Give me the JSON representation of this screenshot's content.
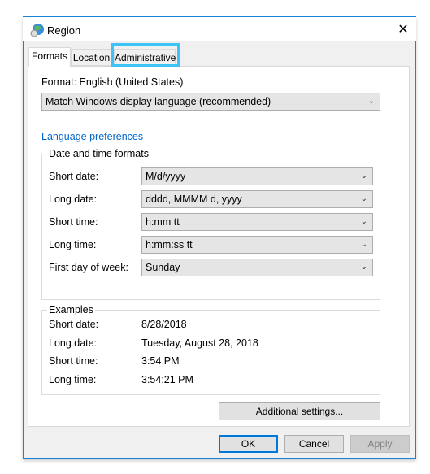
{
  "window": {
    "title": "Region",
    "icon": "globe-clock-icon",
    "close_icon": "close-icon"
  },
  "tabs": [
    {
      "label": "Formats",
      "selected": true
    },
    {
      "label": "Location"
    },
    {
      "label": "Administrative",
      "highlighted": true
    }
  ],
  "format": {
    "label": "Format: English (United States)",
    "value": "Match Windows display language (recommended)"
  },
  "language_link": "Language preferences",
  "date_time": {
    "title": "Date and time formats",
    "rows": [
      {
        "label": "Short date:",
        "value": "M/d/yyyy"
      },
      {
        "label": "Long date:",
        "value": "dddd, MMMM d, yyyy"
      },
      {
        "label": "Short time:",
        "value": "h:mm tt"
      },
      {
        "label": "Long time:",
        "value": "h:mm:ss tt"
      },
      {
        "label": "First day of week:",
        "value": "Sunday"
      }
    ]
  },
  "examples": {
    "title": "Examples",
    "rows": [
      {
        "label": "Short date:",
        "value": "8/28/2018"
      },
      {
        "label": "Long date:",
        "value": "Tuesday, August 28, 2018"
      },
      {
        "label": "Short time:",
        "value": "3:54 PM"
      },
      {
        "label": "Long time:",
        "value": "3:54:21 PM"
      }
    ]
  },
  "buttons": {
    "additional": "Additional settings...",
    "ok": "OK",
    "cancel": "Cancel",
    "apply": "Apply"
  },
  "colors": {
    "accent": "#0078d7",
    "highlight": "#3bc4f5",
    "link": "#0066cc"
  }
}
